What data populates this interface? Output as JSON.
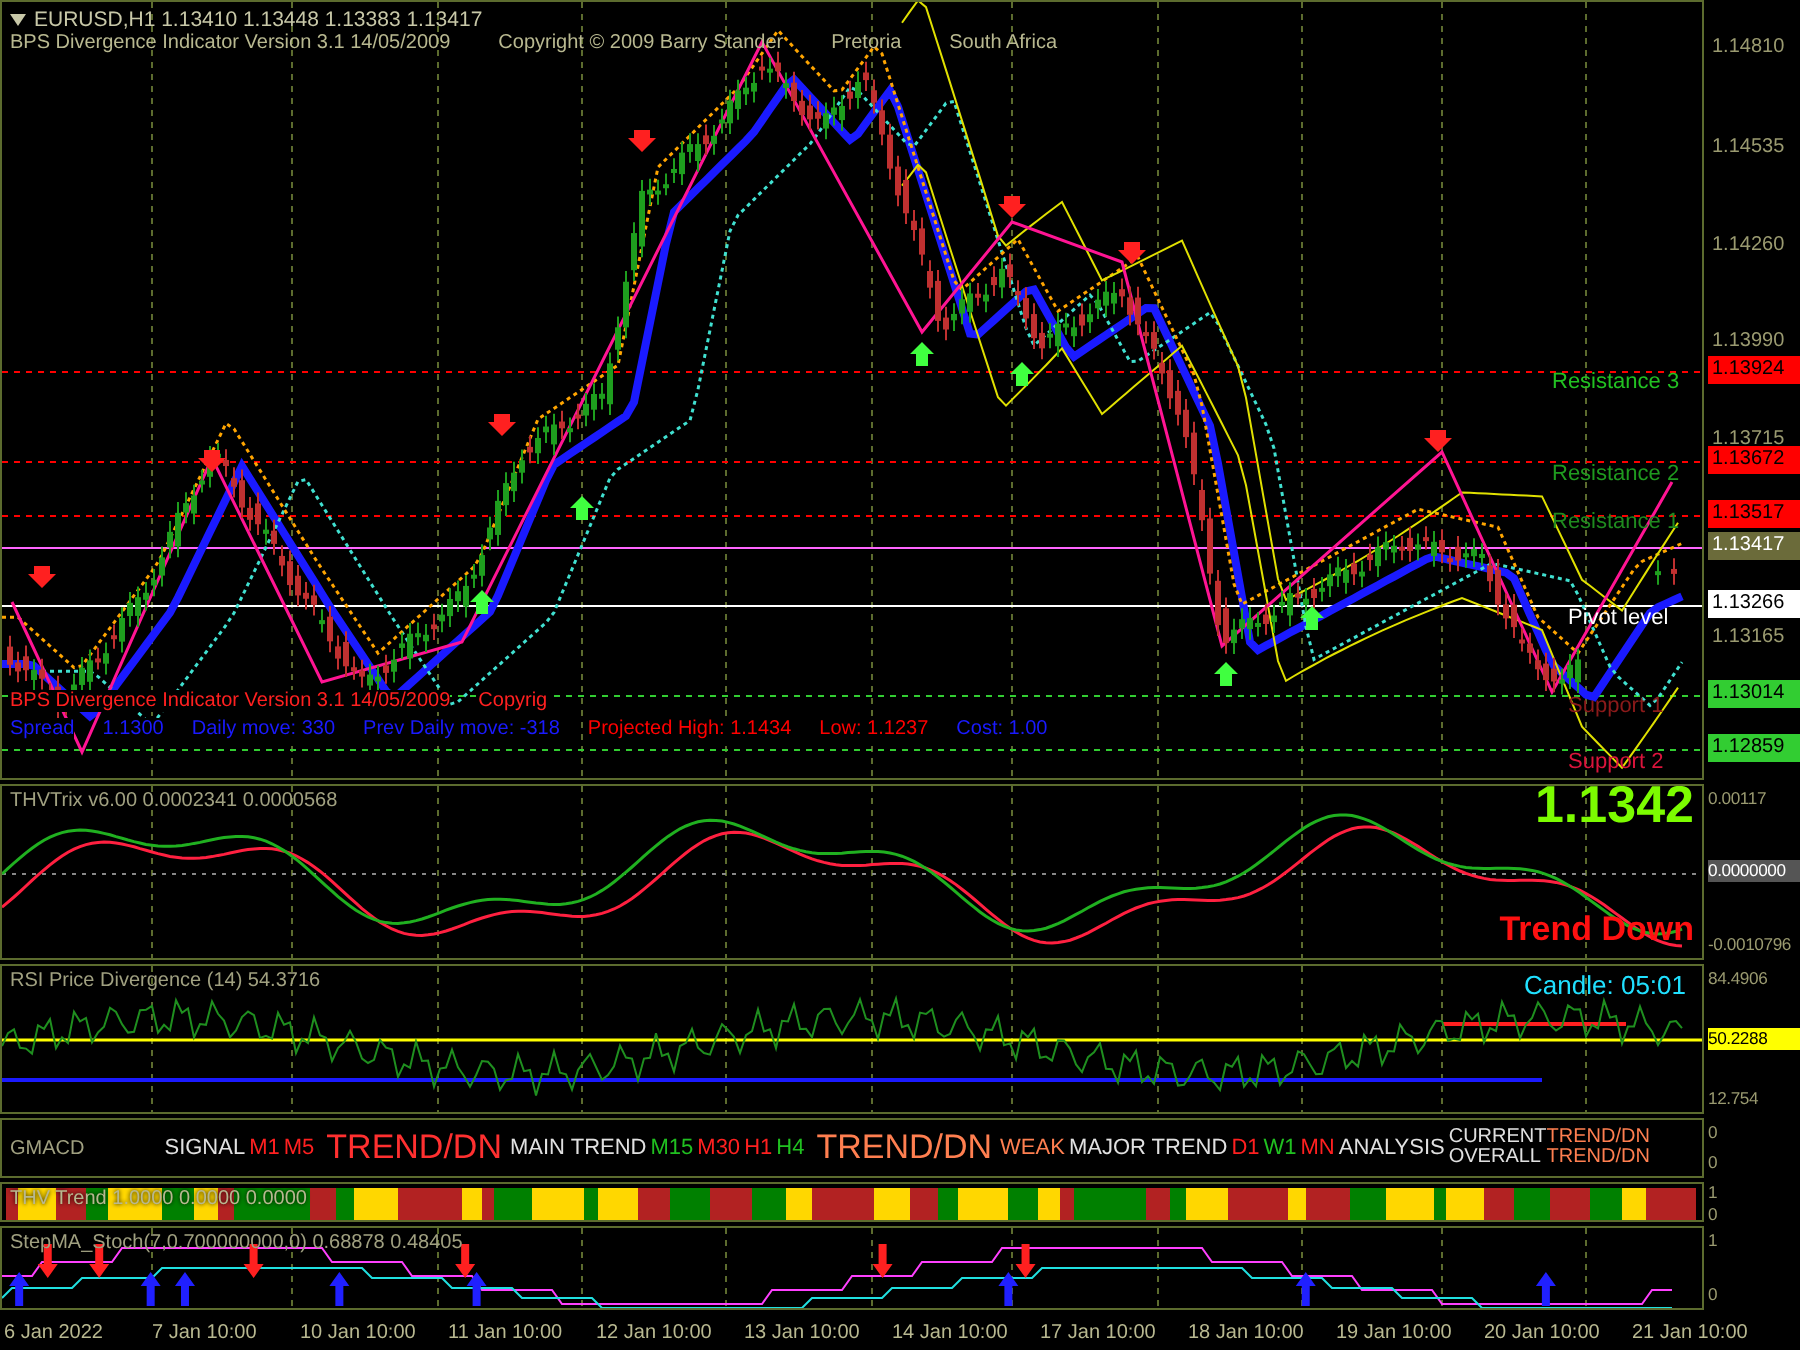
{
  "main_chart": {
    "symbol_line": "EURUSD,H1  1.13410 1.13448 1.13383 1.13417",
    "indicator_line": "BPS Divergence Indicator Version 3.1  14/05/2009",
    "credits": [
      "Copyright © 2009 Barry Stander",
      "Pretoria",
      "South Africa"
    ],
    "price_ticks": [
      "1.14810",
      "1.14535",
      "1.14260",
      "1.13990",
      "1.13715",
      "1.13165"
    ],
    "price_labels": [
      {
        "text": "1.13924",
        "color": "#ff0000"
      },
      {
        "text": "1.13672",
        "color": "#ff0000"
      },
      {
        "text": "1.13517",
        "color": "#ff0000"
      },
      {
        "text": "1.13417",
        "color": "#6b6b3a"
      },
      {
        "text": "1.13266",
        "color": "#ffffff"
      },
      {
        "text": "1.13014",
        "color": "#32cd32"
      },
      {
        "text": "1.12859",
        "color": "#32cd32"
      }
    ],
    "levels": [
      {
        "text": "Resistance 3",
        "color": "#22c022"
      },
      {
        "text": "Resistance 2",
        "color": "#1f9a1f"
      },
      {
        "text": "Resistance 1",
        "color": "#1f8a1f"
      },
      {
        "text": "Pivot level",
        "color": "#ffffff"
      },
      {
        "text": "Support 1",
        "color": "#8b1a1a"
      },
      {
        "text": "Support 2",
        "color": "#dc143c"
      }
    ],
    "info_line_1": [
      "BPS Divergence Indicator Version 3.1  14/05/2009",
      "Copyrig"
    ],
    "info_line_2": [
      {
        "text": "Spread",
        "color": "#1a1aff"
      },
      {
        "text": "1.1300",
        "color": "#1a1aff"
      },
      {
        "text": "Daily move:  330",
        "color": "#1a1aff"
      },
      {
        "text": "Prev Daily move:  -318",
        "color": "#1a1aff"
      },
      {
        "text": "Projected High:  1.1434",
        "color": "#ff0000"
      },
      {
        "text": "Low:  1.1237",
        "color": "#ff0000"
      },
      {
        "text": "Cost:  1.00",
        "color": "#1a1aff"
      }
    ]
  },
  "trix_panel": {
    "title": "THVTrix v6.00 0.0002341 0.0000568",
    "big_price": "1.1342",
    "trend": "Trend Down",
    "axis": [
      "0.00117",
      "0.0000000",
      "-0.0010796"
    ]
  },
  "rsi_panel": {
    "title": "RSI Price Divergence (14) 54.3716",
    "candle": "Candle:  05:01",
    "axis": [
      "84.4906",
      "50.2288",
      "12.754"
    ]
  },
  "gmacd_panel": {
    "title": "GMACD",
    "axis": [
      "0",
      "0"
    ],
    "items": [
      {
        "kind": "small",
        "text": "SIGNAL",
        "color": "#e0e0e0"
      },
      {
        "kind": "small",
        "text": "M1",
        "color": "#ff2020"
      },
      {
        "kind": "small",
        "text": "M5",
        "color": "#ff2020"
      },
      {
        "kind": "large",
        "text": "TREND/DN",
        "color": "#ff3030"
      },
      {
        "kind": "small",
        "text": "MAIN TREND",
        "color": "#e0e0e0"
      },
      {
        "kind": "small",
        "text": "M15",
        "color": "#20c020"
      },
      {
        "kind": "small",
        "text": "M30",
        "color": "#ff2020"
      },
      {
        "kind": "small",
        "text": "H1",
        "color": "#ff2020"
      },
      {
        "kind": "small",
        "text": "H4",
        "color": "#20c020"
      },
      {
        "kind": "large",
        "text": "TREND/DN",
        "color": "#ff7f50"
      },
      {
        "kind": "small",
        "text": "WEAK",
        "color": "#ff7f50"
      },
      {
        "kind": "small",
        "text": "MAJOR TREND",
        "color": "#e0e0e0"
      },
      {
        "kind": "small",
        "text": "D1",
        "color": "#ff2020"
      },
      {
        "kind": "small",
        "text": "W1",
        "color": "#20c020"
      },
      {
        "kind": "small",
        "text": "MN",
        "color": "#ff2020"
      },
      {
        "kind": "small",
        "text": "ANALYSIS",
        "color": "#e0e0e0"
      },
      {
        "kind": "stack",
        "lines": [
          {
            "text": "CURRENT",
            "color": "#e0e0e0"
          },
          {
            "text": "OVERALL",
            "color": "#e0e0e0"
          }
        ]
      },
      {
        "kind": "stack",
        "lines": [
          {
            "text": "TREND/DN",
            "color": "#ff7f50"
          },
          {
            "text": "TREND/DN",
            "color": "#ff7f50"
          }
        ]
      }
    ]
  },
  "thv_trend_panel": {
    "title": "THV Trend 1.0000 0.0000 0.0000",
    "axis": [
      "1",
      "0"
    ]
  },
  "stepma_panel": {
    "title": "StepMA_Stoch(7,0.700000000,0) 0.68878 0.48405",
    "axis": [
      "1",
      "0"
    ]
  },
  "time_axis": [
    "6 Jan 2022",
    "7 Jan 10:00",
    "10 Jan 10:00",
    "11 Jan 10:00",
    "12 Jan 10:00",
    "13 Jan 10:00",
    "14 Jan 10:00",
    "17 Jan 10:00",
    "18 Jan 10:00",
    "19 Jan 10:00",
    "20 Jan 10:00",
    "21 Jan 10:00"
  ]
}
